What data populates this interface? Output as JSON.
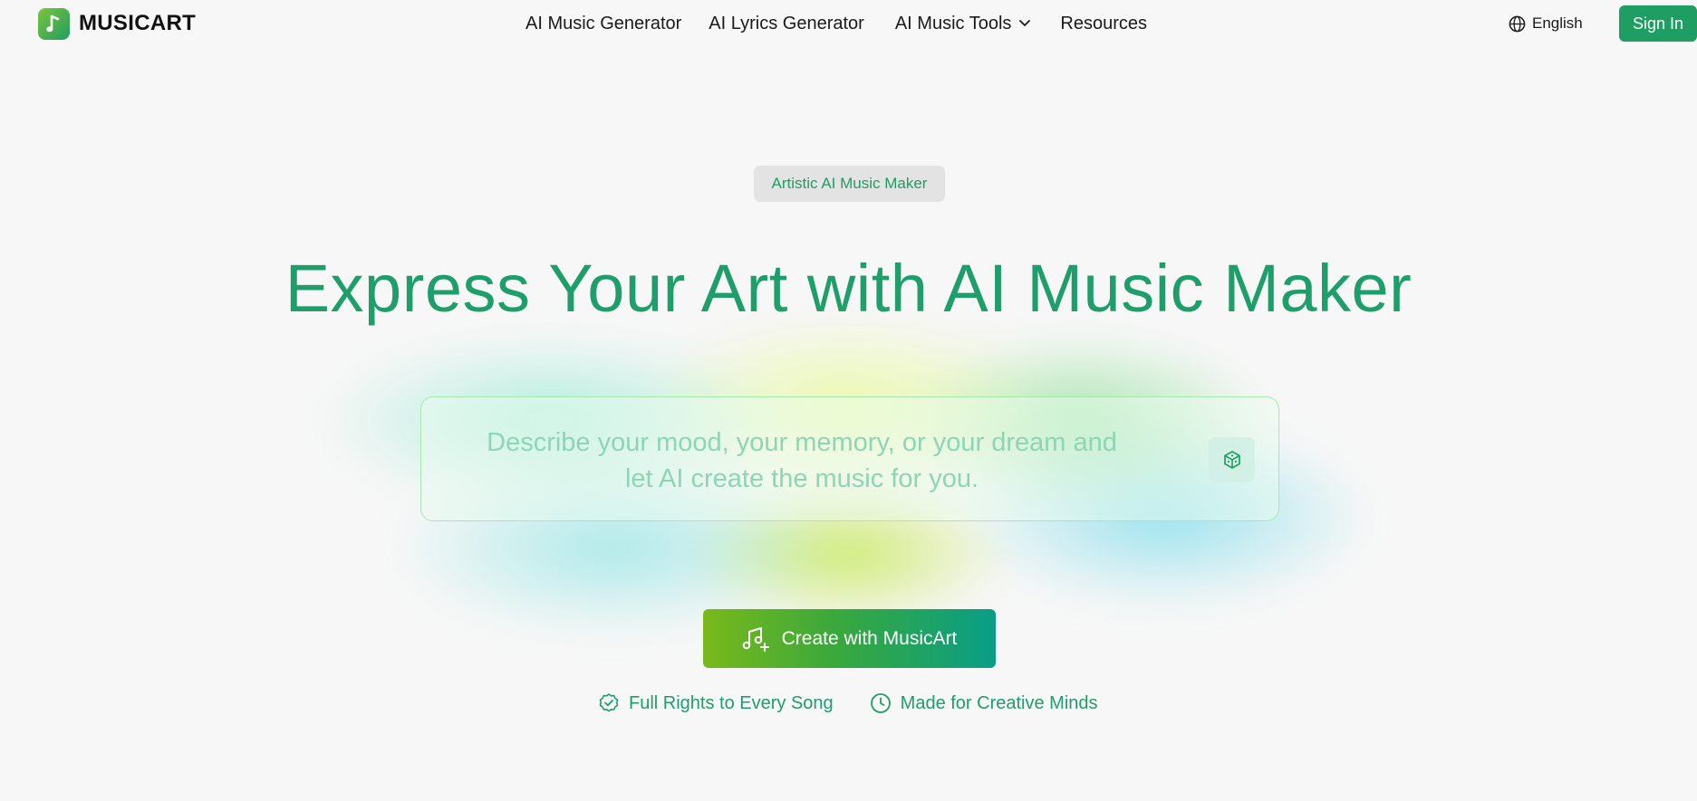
{
  "header": {
    "logo_text": "MUSICART",
    "nav": [
      {
        "label": "AI Music Generator"
      },
      {
        "label": "AI Lyrics Generator"
      },
      {
        "label": "AI Music Tools"
      },
      {
        "label": "Resources"
      }
    ],
    "language": "English",
    "sign_in": "Sign In"
  },
  "hero": {
    "badge": "Artistic AI Music Maker",
    "headline": "Express Your Art with AI Music Maker",
    "prompt_placeholder": "Describe your mood, your memory, or your dream and let AI create the music for you.",
    "create_button": "Create with MusicArt",
    "features": [
      {
        "label": "Full Rights to Every Song",
        "icon": "badge-check-icon"
      },
      {
        "label": "Made for Creative Minds",
        "icon": "clock-icon"
      }
    ]
  },
  "colors": {
    "brand_green": "#1e9e62",
    "headline": "#1e9e6a",
    "background": "#f7f7f7"
  }
}
